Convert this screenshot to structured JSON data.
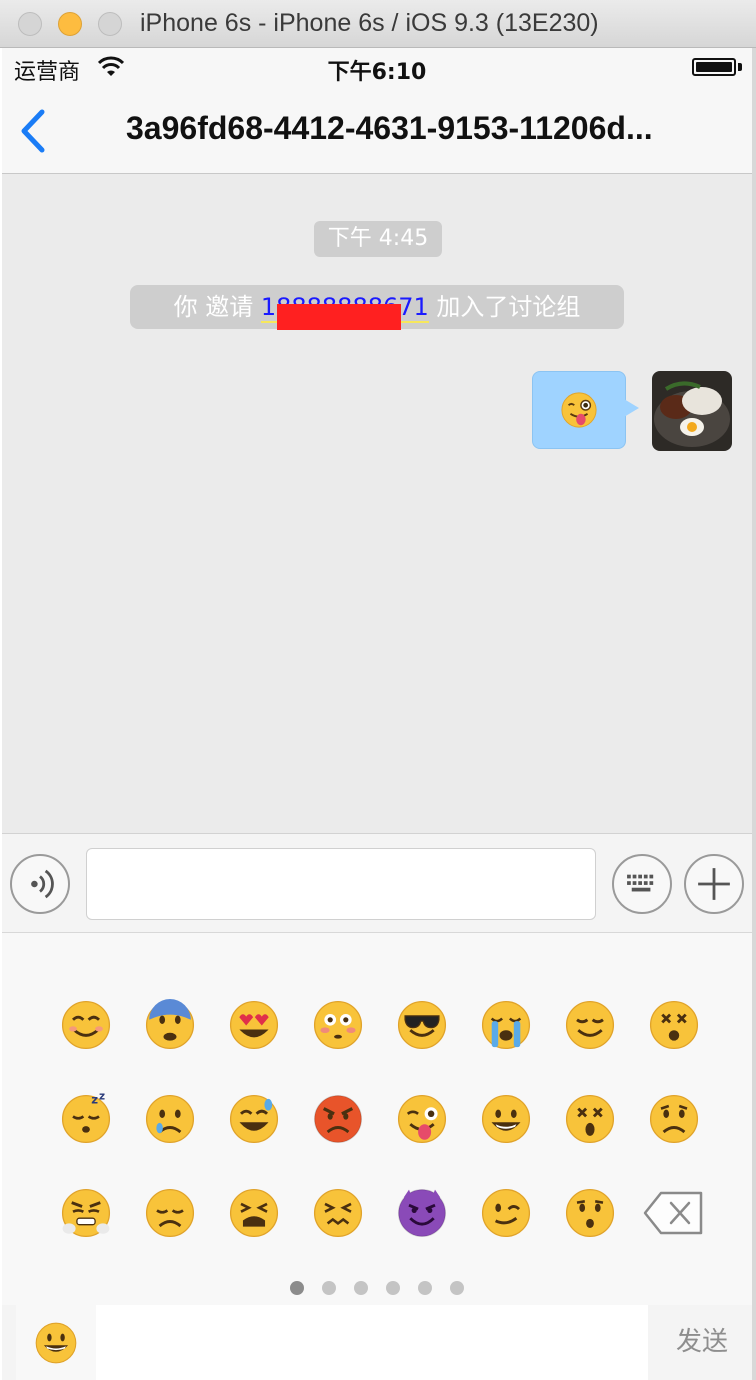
{
  "window": {
    "title": "iPhone 6s - iPhone 6s / iOS 9.3 (13E230)"
  },
  "status_bar": {
    "carrier": "运营商",
    "time": "下午6:10"
  },
  "nav": {
    "title": "3a96fd68-4412-4631-9153-11206d..."
  },
  "chat": {
    "timestamp": "下午 4:45",
    "system_message": {
      "prefix": "你 邀请 ",
      "phone": "18888888671",
      "suffix": " 加入了讨论组"
    }
  },
  "bottom_bar": {
    "send_label": "发送"
  },
  "emoji_page": {
    "count": 6,
    "active_index": 0
  },
  "colors": {
    "accent": "#1a7cf6",
    "bubble": "#9fd3ff",
    "redaction": "#ff2020"
  }
}
